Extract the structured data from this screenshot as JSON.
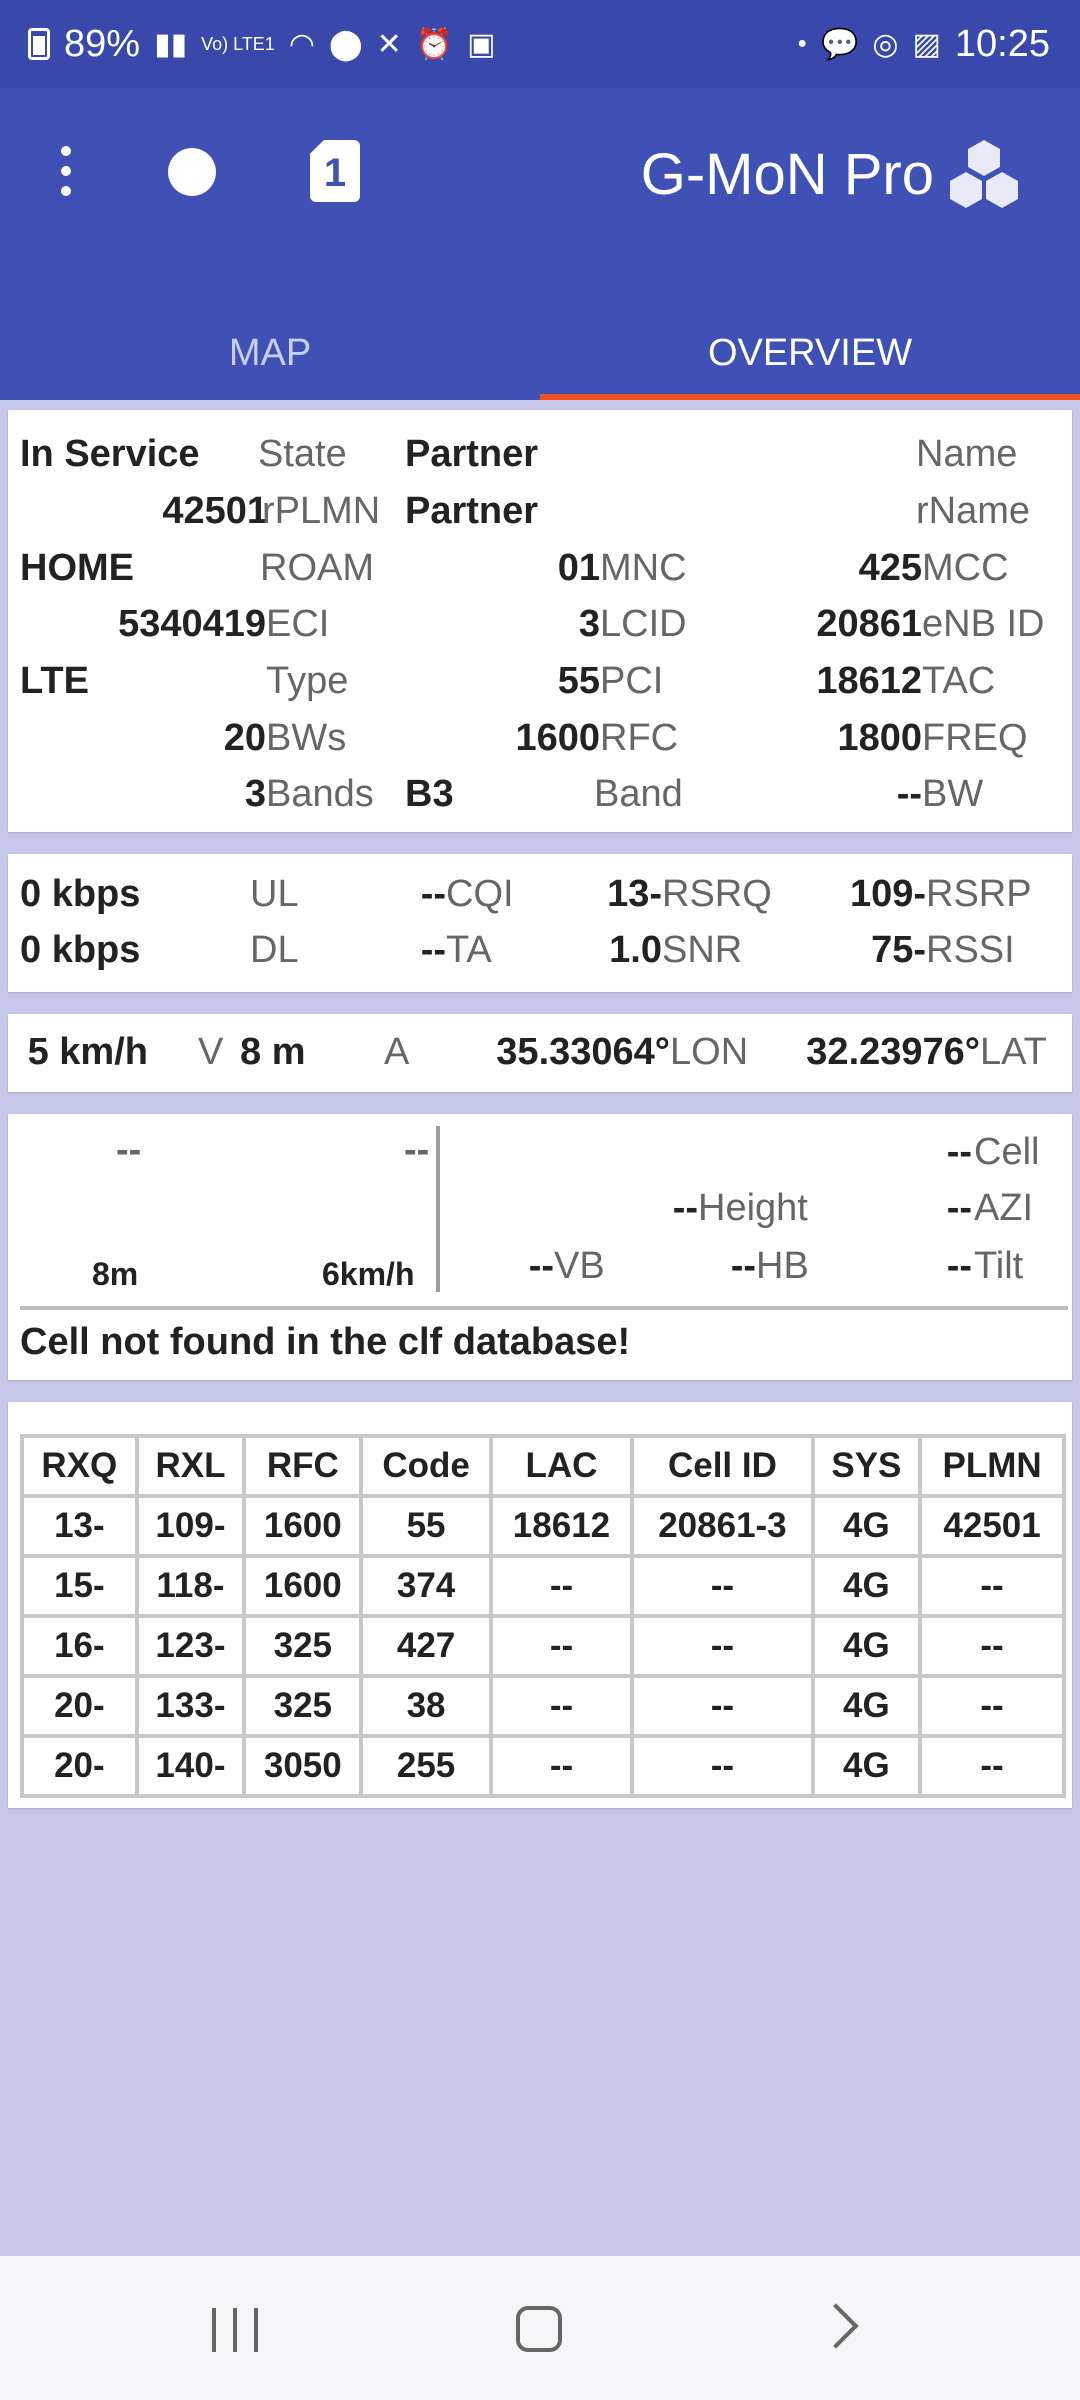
{
  "status_bar": {
    "battery_percent": "89%",
    "time": "10:25",
    "signal_label": "Vo) LTE1"
  },
  "app": {
    "title": "G-MoN Pro",
    "sim_number": "1"
  },
  "tabs": [
    {
      "label": "MAP",
      "active": false
    },
    {
      "label": "OVERVIEW",
      "active": true
    }
  ],
  "serving": {
    "state_value": "In Service",
    "state_label": "State",
    "name_value": "Partner",
    "name_label": "Name",
    "rplmn_value": "42501",
    "rplmn_label": "rPLMN",
    "rname_value": "Partner",
    "rname_label": "rName",
    "home_value": "HOME",
    "roam_label": "ROAM",
    "mnc_value": "01",
    "mnc_label": "MNC",
    "mcc_value": "425",
    "mcc_label": "MCC",
    "eci_value": "5340419",
    "eci_label": "ECI",
    "lcid_value": "3",
    "lcid_label": "LCID",
    "enb_value": "20861",
    "enb_label": "eNB ID",
    "type_value": "LTE",
    "type_label": "Type",
    "pci_value": "55",
    "pci_label": "PCI",
    "tac_value": "18612",
    "tac_label": "TAC",
    "bws_value": "20",
    "bws_label": "BWs",
    "rfc_value": "1600",
    "rfc_label": "RFC",
    "freq_value": "1800",
    "freq_label": "FREQ",
    "bands_value": "3",
    "bands_label": "Bands",
    "band_value": "B3",
    "band_label": "Band",
    "bw_value": "--",
    "bw_label": "BW"
  },
  "signal": {
    "ul_value": "0 kbps",
    "ul_label": "UL",
    "cqi_value": "--",
    "cqi_label": "CQI",
    "rsrq_value": "13-",
    "rsrq_label": "RSRQ",
    "rsrp_value": "109-",
    "rsrp_label": "RSRP",
    "dl_value": "0 kbps",
    "dl_label": "DL",
    "ta_value": "--",
    "ta_label": "TA",
    "snr_value": "1.0",
    "snr_label": "SNR",
    "rssi_value": "75-",
    "rssi_label": "RSSI"
  },
  "location": {
    "speed_value": "5 km/h",
    "speed_label": "V",
    "alt_value": "8 m",
    "alt_label": "A",
    "lon_value": "35.33064°",
    "lon_label": "LON",
    "lat_value": "32.23976°",
    "lat_label": "LAT"
  },
  "cell_info": {
    "left_top_1": "--",
    "left_top_2": "--",
    "alt_small": "8m",
    "speed_small": "6km/h",
    "cell_value": "--",
    "cell_label": "Cell",
    "height_value": "--",
    "height_label": "Height",
    "azi_value": "--",
    "azi_label": "AZI",
    "vb_value": "--",
    "vb_label": "VB",
    "hb_value": "--",
    "hb_label": "HB",
    "tilt_value": "--",
    "tilt_label": "Tilt",
    "message": "Cell not found in the clf database!"
  },
  "neighbours": {
    "headers": [
      "RXQ",
      "RXL",
      "RFC",
      "Code",
      "LAC",
      "Cell ID",
      "SYS",
      "PLMN"
    ],
    "rows": [
      [
        "13-",
        "109-",
        "1600",
        "55",
        "18612",
        "20861-3",
        "4G",
        "42501"
      ],
      [
        "15-",
        "118-",
        "1600",
        "374",
        "--",
        "--",
        "4G",
        "--"
      ],
      [
        "16-",
        "123-",
        "325",
        "427",
        "--",
        "--",
        "4G",
        "--"
      ],
      [
        "20-",
        "133-",
        "325",
        "38",
        "--",
        "--",
        "4G",
        "--"
      ],
      [
        "20-",
        "140-",
        "3050",
        "255",
        "--",
        "--",
        "4G",
        "--"
      ]
    ]
  }
}
